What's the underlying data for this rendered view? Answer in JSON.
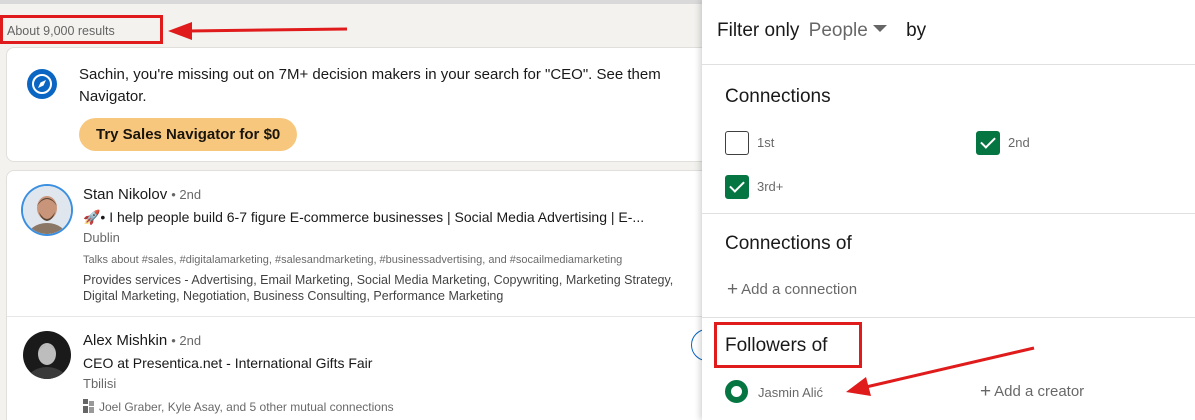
{
  "search": {
    "results_count": "About 9,000 results"
  },
  "promo": {
    "icon": "compass-icon",
    "text_line1": "Sachin, you're missing out on 7M+ decision makers in your search for \"CEO\". See them",
    "text_line2": "Navigator.",
    "button_label": "Try Sales Navigator for $0"
  },
  "results": [
    {
      "name": "Stan Nikolov",
      "degree": "• 2nd",
      "headline": "🚀• I help people build 6-7 figure E-commerce businesses | Social Media Advertising | E-...",
      "location": "Dublin",
      "talks_about": "Talks about #sales, #digitalamarketing, #salesandmarketing, #businessadvertising, and #socailmediamarketing",
      "services": "Provides services - Advertising, Email Marketing, Social Media Marketing, Copywriting, Marketing Strategy, Digital Marketing, Negotiation, Business Consulting, Performance Marketing"
    },
    {
      "name": "Alex Mishkin",
      "degree": "• 2nd",
      "headline": "CEO at Presentica.net - International Gifts Fair",
      "location": "Tbilisi",
      "mutual": "Joel Graber, Kyle Asay, and 5 other mutual connections"
    }
  ],
  "filter_panel": {
    "header": {
      "prefix": "Filter only",
      "selected_type": "People",
      "suffix": "by"
    },
    "connections": {
      "title": "Connections",
      "options": [
        {
          "label": "1st",
          "checked": false
        },
        {
          "label": "2nd",
          "checked": true
        },
        {
          "label": "3rd+",
          "checked": true
        }
      ]
    },
    "connections_of": {
      "title": "Connections of",
      "add_label": "Add a connection"
    },
    "followers_of": {
      "title": "Followers of",
      "selected": "Jasmin Alić",
      "add_label": "Add a creator"
    }
  },
  "colors": {
    "accent_green": "#057642",
    "linkedin_blue": "#0a66c2",
    "promo_button": "#f8c77e",
    "annotation_red": "#e01b1b"
  }
}
